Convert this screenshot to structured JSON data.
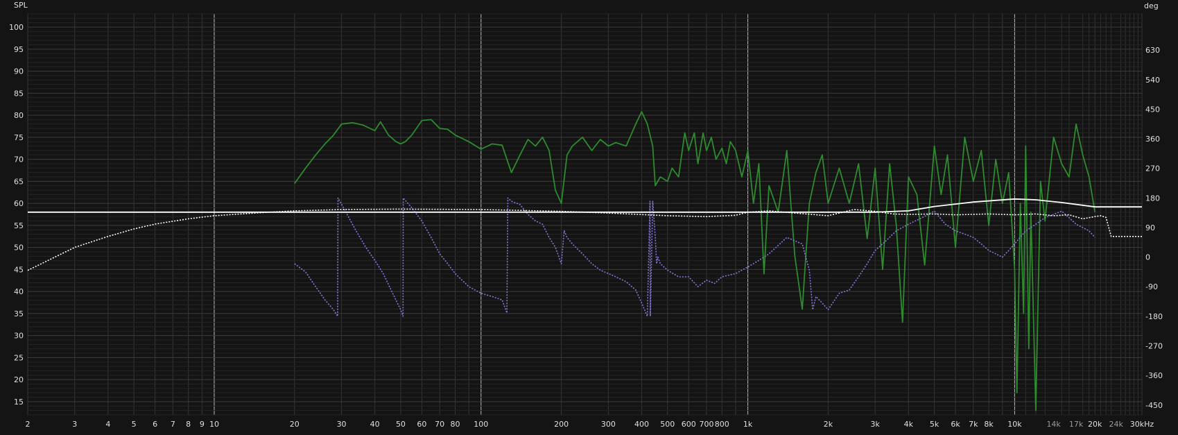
{
  "chart_data": {
    "type": "line",
    "left_axis_label": "SPL",
    "right_axis_label": "deg",
    "x_scale": "log",
    "xlim": [
      2,
      30000
    ],
    "ylim": [
      12,
      103
    ],
    "y2lim": [
      -480,
      740
    ],
    "grid": true,
    "x_ticks": [
      {
        "v": 2,
        "t": "2"
      },
      {
        "v": 3,
        "t": "3"
      },
      {
        "v": 4,
        "t": "4"
      },
      {
        "v": 5,
        "t": "5"
      },
      {
        "v": 6,
        "t": "6"
      },
      {
        "v": 7,
        "t": "7"
      },
      {
        "v": 8,
        "t": "8"
      },
      {
        "v": 9,
        "t": "9"
      },
      {
        "v": 10,
        "t": "10"
      },
      {
        "v": 20,
        "t": "20"
      },
      {
        "v": 30,
        "t": "30"
      },
      {
        "v": 40,
        "t": "40"
      },
      {
        "v": 50,
        "t": "50"
      },
      {
        "v": 60,
        "t": "60"
      },
      {
        "v": 70,
        "t": "70"
      },
      {
        "v": 80,
        "t": "80"
      },
      {
        "v": 100,
        "t": "100"
      },
      {
        "v": 200,
        "t": "200"
      },
      {
        "v": 300,
        "t": "300"
      },
      {
        "v": 400,
        "t": "400"
      },
      {
        "v": 500,
        "t": "500"
      },
      {
        "v": 600,
        "t": "600"
      },
      {
        "v": 700,
        "t": "700"
      },
      {
        "v": 800,
        "t": "800"
      },
      {
        "v": 1000,
        "t": "1k"
      },
      {
        "v": 2000,
        "t": "2k"
      },
      {
        "v": 3000,
        "t": "3k"
      },
      {
        "v": 4000,
        "t": "4k"
      },
      {
        "v": 5000,
        "t": "5k"
      },
      {
        "v": 6000,
        "t": "6k"
      },
      {
        "v": 7000,
        "t": "7k"
      },
      {
        "v": 8000,
        "t": "8k"
      },
      {
        "v": 10000,
        "t": "10k"
      },
      {
        "v": 14000,
        "t": "14k"
      },
      {
        "v": 17000,
        "t": "17k"
      },
      {
        "v": 20000,
        "t": "20k"
      },
      {
        "v": 24000,
        "t": "24k"
      },
      {
        "v": 30000,
        "t": "30kHz"
      }
    ],
    "y_ticks": [
      15,
      20,
      25,
      30,
      35,
      40,
      45,
      50,
      55,
      60,
      65,
      70,
      75,
      80,
      85,
      90,
      95,
      100
    ],
    "y2_ticks": [
      -450,
      -360,
      -270,
      -180,
      -90,
      0,
      90,
      180,
      270,
      360,
      450,
      540,
      630
    ],
    "series": [
      {
        "color": "#2e8b2e",
        "axis": "left",
        "style": "solid",
        "x": [
          20,
          22,
          24,
          26,
          28,
          30,
          33,
          36,
          40,
          42,
          45,
          48,
          50,
          52,
          55,
          60,
          65,
          70,
          75,
          80,
          90,
          100,
          110,
          120,
          130,
          140,
          150,
          160,
          170,
          180,
          190,
          200,
          210,
          220,
          240,
          260,
          280,
          300,
          320,
          350,
          380,
          400,
          420,
          440,
          450,
          470,
          500,
          520,
          550,
          580,
          600,
          630,
          650,
          680,
          700,
          730,
          760,
          800,
          830,
          860,
          900,
          950,
          1000,
          1050,
          1100,
          1150,
          1200,
          1300,
          1400,
          1500,
          1600,
          1700,
          1800,
          1900,
          2000,
          2200,
          2400,
          2600,
          2800,
          3000,
          3200,
          3400,
          3600,
          3800,
          4000,
          4300,
          4600,
          5000,
          5300,
          5600,
          6000,
          6500,
          7000,
          7500,
          8000,
          8500,
          9000,
          9500,
          10000,
          10200,
          10500,
          10800,
          11000,
          11300,
          11500,
          12000,
          12500,
          13000,
          14000,
          15000,
          16000,
          17000,
          18000,
          19000,
          20000
        ],
        "y": [
          64.5,
          68,
          71,
          73.5,
          75.5,
          78,
          78.3,
          77.8,
          76.5,
          78.5,
          75.5,
          74,
          73.5,
          74,
          75.5,
          78.8,
          79,
          77,
          76.8,
          75.5,
          74,
          72.3,
          73.5,
          73.2,
          67,
          71,
          74.5,
          73,
          75,
          72,
          63,
          60,
          71,
          73,
          75,
          72,
          74.5,
          73,
          73.8,
          73,
          78,
          80.8,
          78,
          73,
          64,
          66,
          65,
          68,
          66,
          76,
          72,
          76,
          69,
          76,
          72,
          75,
          70,
          72.5,
          69,
          74,
          72,
          66,
          72,
          60,
          69,
          44,
          64,
          58,
          72,
          48,
          36,
          60,
          67,
          71,
          60,
          68,
          60,
          69,
          52,
          68,
          45,
          69,
          55,
          33,
          66,
          62,
          46,
          73,
          62,
          71,
          50,
          75,
          65,
          72,
          55,
          70,
          60,
          67,
          45,
          17,
          60,
          35,
          73,
          27,
          58,
          13,
          65,
          56,
          75,
          69,
          66,
          78,
          71,
          66,
          58
        ]
      },
      {
        "color": "#8878e0",
        "axis": "right",
        "style": "dotted",
        "x": [
          20,
          22,
          24,
          26,
          28,
          29,
          29.1,
          31,
          34,
          37,
          40,
          43,
          46,
          50,
          51,
          51.1,
          55,
          60,
          65,
          70,
          75,
          80,
          90,
          100,
          110,
          120,
          125,
          126,
          130,
          140,
          150,
          160,
          170,
          180,
          190,
          200,
          205,
          210,
          220,
          240,
          260,
          280,
          300,
          320,
          350,
          380,
          400,
          420,
          430,
          431,
          440,
          450,
          455,
          460,
          470,
          500,
          550,
          600,
          650,
          700,
          750,
          800,
          900,
          1000,
          1100,
          1200,
          1400,
          1600,
          1700,
          1750,
          1800,
          1900,
          2000,
          2200,
          2400,
          2600,
          2800,
          3000,
          3300,
          3600,
          4000,
          4500,
          5000,
          5500,
          6000,
          6500,
          7000,
          7500,
          8000,
          8500,
          9000,
          9500,
          10000,
          11000,
          12000,
          13000,
          14000,
          15000,
          16000,
          17000,
          18000,
          19000,
          20000
        ],
        "y": [
          -20,
          -45,
          -90,
          -130,
          -160,
          -180,
          180,
          140,
          80,
          30,
          -10,
          -50,
          -100,
          -160,
          -180,
          180,
          150,
          110,
          60,
          10,
          -20,
          -50,
          -90,
          -110,
          -120,
          -130,
          -170,
          180,
          170,
          160,
          130,
          110,
          100,
          60,
          30,
          -20,
          80,
          60,
          40,
          10,
          -20,
          -40,
          -50,
          -60,
          -75,
          -100,
          -140,
          -180,
          170,
          -180,
          170,
          60,
          -20,
          0,
          -20,
          -40,
          -60,
          -60,
          -90,
          -70,
          -80,
          -60,
          -50,
          -30,
          -10,
          10,
          60,
          40,
          -40,
          -160,
          -120,
          -140,
          -160,
          -110,
          -100,
          -60,
          -20,
          20,
          50,
          80,
          100,
          120,
          140,
          100,
          80,
          70,
          60,
          40,
          20,
          10,
          0,
          20,
          40,
          80,
          100,
          120,
          130,
          140,
          120,
          100,
          90,
          80,
          60
        ]
      },
      {
        "color": "#ffffff",
        "axis": "left",
        "style": "solid",
        "x": [
          2,
          10,
          50,
          100,
          200,
          500,
          1000,
          2000,
          3000,
          4000,
          5000,
          7000,
          10000,
          12000,
          15000,
          20000,
          30000
        ],
        "y": [
          58,
          58,
          58,
          58,
          58,
          58,
          58,
          58,
          58,
          58.3,
          59.3,
          60.3,
          61,
          60.8,
          60.2,
          59.2,
          59.2
        ]
      },
      {
        "color": "#ffffff",
        "axis": "left",
        "style": "dotted",
        "x": [
          2,
          3,
          4,
          5,
          6,
          8,
          10,
          15,
          20,
          30,
          50,
          100,
          200,
          300,
          500,
          700,
          900,
          1000,
          1200,
          1500,
          2000,
          2500,
          3000,
          3500,
          4000,
          5000,
          6000,
          8000,
          10000,
          12000,
          14000,
          16000,
          18000,
          20000,
          21000,
          22000,
          23000,
          25000,
          30000
        ],
        "y": [
          44.8,
          50,
          52.5,
          54.2,
          55.3,
          56.5,
          57.2,
          57.9,
          58.3,
          58.6,
          58.7,
          58.6,
          58.2,
          57.8,
          57.2,
          57.0,
          57.3,
          58,
          58.3,
          57.8,
          57.2,
          58.6,
          58.2,
          57.6,
          57.5,
          57.6,
          57.4,
          57.6,
          57.4,
          57.6,
          57.2,
          57.4,
          56.5,
          57.0,
          57.2,
          56.8,
          52.5,
          52.5,
          52.5
        ]
      }
    ]
  }
}
